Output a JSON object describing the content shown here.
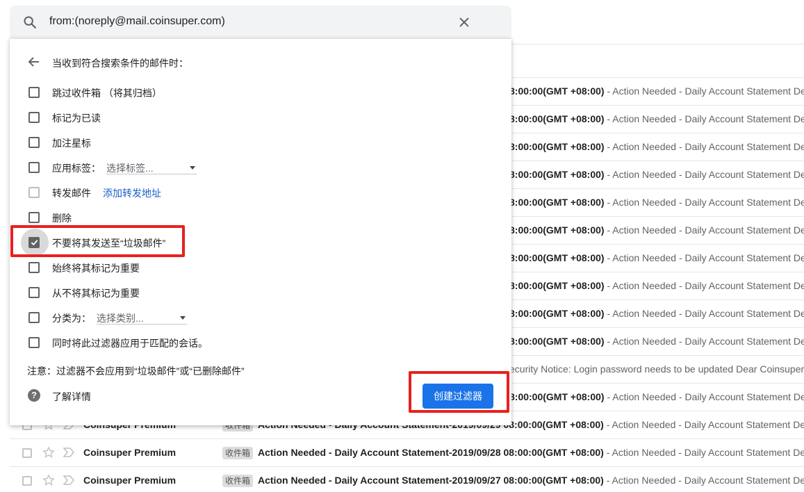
{
  "search": {
    "query": "from:(noreply@mail.coinsuper.com)"
  },
  "filter_panel": {
    "header": "当收到符合搜索条件的邮件时：",
    "options": [
      {
        "label": "跳过收件箱 （将其归档）",
        "checked": false
      },
      {
        "label": "标记为已读",
        "checked": false
      },
      {
        "label": "加注星标",
        "checked": false
      },
      {
        "label": "应用标签：",
        "checked": false,
        "select": "选择标签..."
      },
      {
        "label": "转发邮件",
        "checked": false,
        "link": "添加转发地址"
      },
      {
        "label": "删除",
        "checked": false
      },
      {
        "label": "不要将其发送至“垃圾邮件”",
        "checked": true
      },
      {
        "label": "始终将其标记为重要",
        "checked": false
      },
      {
        "label": "从不将其标记为重要",
        "checked": false
      },
      {
        "label": "分类为：",
        "checked": false,
        "select": "选择类别..."
      },
      {
        "label": "同时将此过滤器应用于匹配的会话。",
        "checked": false
      }
    ],
    "note": "注意：过滤器不会应用到“垃圾邮件”或“已删除邮件”",
    "help_label": "了解详情",
    "create_button": "创建过滤器"
  },
  "mail_list": {
    "fragment": "8:00:00(GMT +08:00)",
    "snippet": " - Action Needed - Daily Account Statement Details",
    "security_fragment": "ecurity Notice: Login password needs to be updated Dear Coinsuper user",
    "sender": "Coinsuper Premium",
    "label": "收件箱",
    "subject_prefix": "Action Needed - Daily Account Statement-",
    "visible_rows": [
      {
        "date": "2019/09/29 08:00:00(GMT +08:00)"
      },
      {
        "date": "2019/09/28 08:00:00(GMT +08:00)"
      },
      {
        "date": "2019/09/27 08:00:00(GMT +08:00)"
      }
    ]
  },
  "colors": {
    "accent": "#1a73e8",
    "highlight": "#e8211f",
    "link": "#1a5fc8"
  }
}
